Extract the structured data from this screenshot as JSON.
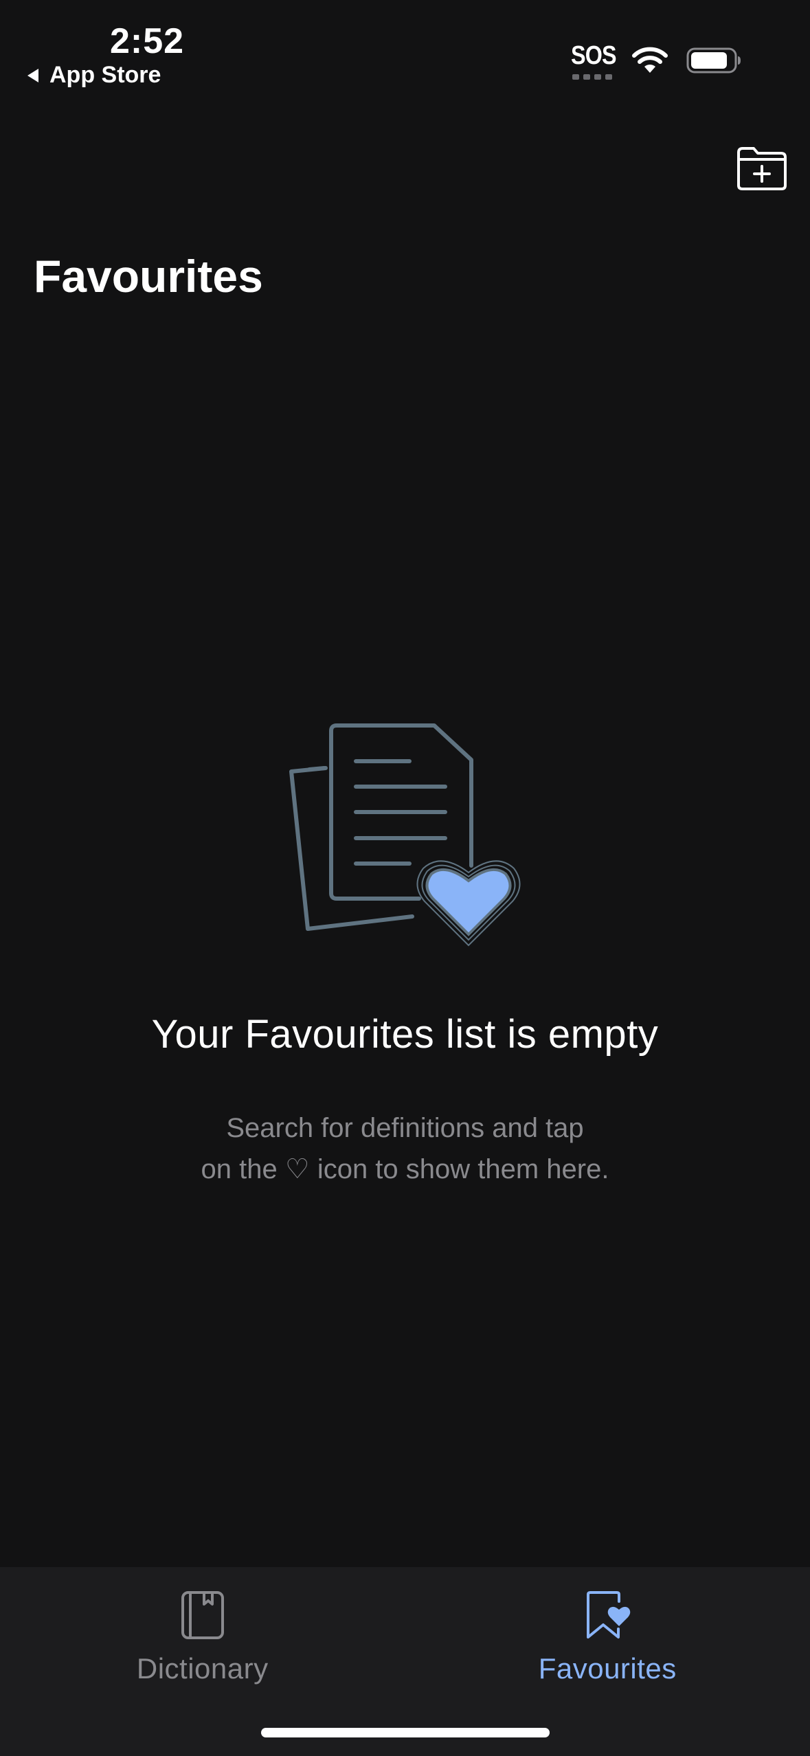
{
  "status_bar": {
    "time": "2:52",
    "back_label": "App Store",
    "sos": "SOS"
  },
  "header": {
    "title": "Favourites",
    "folder_add_icon": "folder-add-icon"
  },
  "empty_state": {
    "title": "Your Favourites list is empty",
    "description_line1": "Search for definitions and tap",
    "description_line2": "on the ♡ icon to show them here.",
    "illustration_icon": "documents-heart-icon"
  },
  "tab_bar": {
    "tabs": [
      {
        "label": "Dictionary",
        "icon": "book-icon",
        "selected": false
      },
      {
        "label": "Favourites",
        "icon": "bookmark-heart-icon",
        "selected": true
      }
    ]
  },
  "colors": {
    "background": "#121213",
    "tab_bar_background": "#1c1c1e",
    "accent": "#8ab4f8",
    "illustration_stroke": "#5f7381",
    "secondary_text": "#8a8a8e"
  }
}
